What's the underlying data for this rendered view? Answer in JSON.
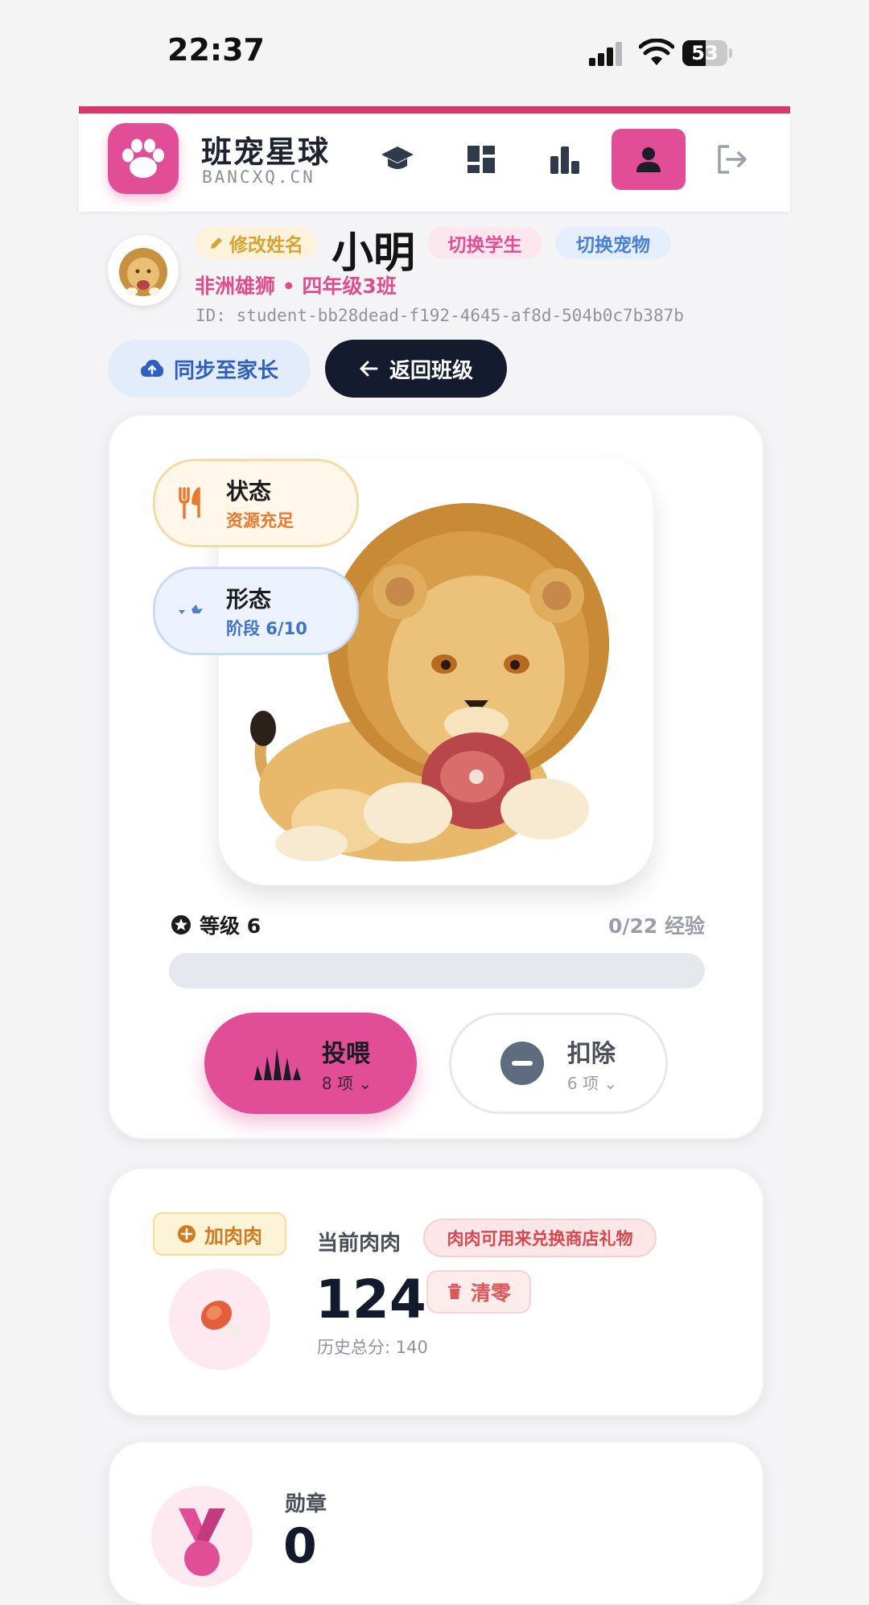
{
  "status_bar": {
    "time": "22:37",
    "battery": "53"
  },
  "app": {
    "name": "班宠星球",
    "domain": "BANCXQ.CN",
    "nav": [
      "graduation-cap-icon",
      "dashboard-icon",
      "bar-chart-icon",
      "user-icon",
      "logout-icon"
    ],
    "accent_color": "#e14d96"
  },
  "profile": {
    "rename_label": "修改姓名",
    "name": "小明",
    "switch_student_label": "切换学生",
    "switch_pet_label": "切换宠物",
    "subline": "非洲雄狮 • 四年级3班",
    "id_text": "ID: student-bb28dead-f192-4645-af8d-504b0c7b387b",
    "sync_label": "同步至家长",
    "back_label": "返回班级"
  },
  "pet": {
    "status_title": "状态",
    "status_value": "资源充足",
    "form_title": "形态",
    "form_value": "阶段 6/10",
    "level_label": "等级 6",
    "exp_text": "0/22 经验",
    "exp_progress": 0,
    "feed_label": "投喂",
    "feed_count": "8 项",
    "deduct_label": "扣除",
    "deduct_count": "6 项"
  },
  "meat": {
    "add_label": "加肉肉",
    "label": "当前肉肉",
    "tip": "肉肉可用来兑换商店礼物",
    "value": "124",
    "reset_label": "清零",
    "history": "历史总分: 140"
  },
  "badges": {
    "label": "勋章",
    "value": "0"
  }
}
